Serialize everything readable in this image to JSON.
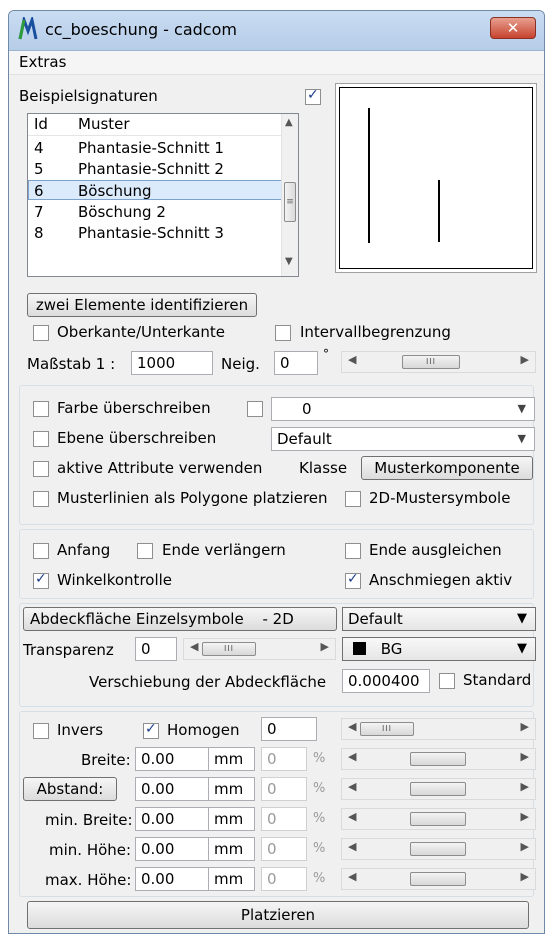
{
  "window": {
    "title": "cc_boeschung - cadcom",
    "close_glyph": "✕"
  },
  "menu": {
    "extras": "Extras"
  },
  "signatures": {
    "label": "Beispielsignaturen",
    "checked": true,
    "headers": {
      "id": "Id",
      "muster": "Muster"
    },
    "rows": [
      {
        "id": "4",
        "name": "Phantasie-Schnitt 1",
        "selected": false
      },
      {
        "id": "5",
        "name": "Phantasie-Schnitt 2",
        "selected": false
      },
      {
        "id": "6",
        "name": "Böschung",
        "selected": true
      },
      {
        "id": "7",
        "name": "Böschung 2",
        "selected": false
      },
      {
        "id": "8",
        "name": "Phantasie-Schnitt 3",
        "selected": false
      }
    ]
  },
  "identify": {
    "label": "zwei Elemente identifizieren"
  },
  "options1": {
    "oberkante": "Oberkante/Unterkante",
    "intervall": "Intervallbegrenzung",
    "massstab_label": "Maßstab 1 :",
    "massstab_value": "1000",
    "neig_label": "Neig.",
    "neig_value": "0",
    "degree": "°"
  },
  "overrides": {
    "farbe": "Farbe überschreiben",
    "farbe_value": "0",
    "ebene": "Ebene überschreiben",
    "ebene_value": "Default",
    "aktive": "aktive Attribute verwenden",
    "klasse_label": "Klasse",
    "klasse_value": "Musterkomponente",
    "polygone": "Musterlinien als Polygone platzieren",
    "muster2d": "2D-Mustersymbole"
  },
  "ends": {
    "anfang": "Anfang",
    "ende_verl": "Ende verlängern",
    "ende_ausgl": "Ende ausgleichen",
    "winkel": "Winkelkontrolle",
    "winkel_checked": true,
    "anschmiegen": "Anschmiegen aktiv",
    "anschmiegen_checked": true
  },
  "cover": {
    "mode": "Abdeckfläche Einzelsymbole",
    "mode_suffix": "- 2D",
    "level": "Default",
    "transparenz_label": "Transparenz",
    "transparenz_value": "0",
    "color": "BG",
    "color_swatch": "#000000",
    "shift_label": "Verschiebung der Abdeckfläche",
    "shift_value": "0.000400",
    "standard": "Standard"
  },
  "dims": {
    "invers": "Invers",
    "homogen": "Homogen",
    "homogen_checked": true,
    "homogen_value": "0",
    "rows": [
      {
        "label": "Breite:",
        "value": "0.00",
        "unit": "mm",
        "pct": "0",
        "pct_unit": "%",
        "is_button": false
      },
      {
        "label": "Abstand:",
        "value": "0.00",
        "unit": "mm",
        "pct": "0",
        "pct_unit": "%",
        "is_button": true
      },
      {
        "label": "min. Breite:",
        "value": "0.00",
        "unit": "mm",
        "pct": "0",
        "pct_unit": "%",
        "is_button": false
      },
      {
        "label": "min. Höhe:",
        "value": "0.00",
        "unit": "mm",
        "pct": "0",
        "pct_unit": "%",
        "is_button": false
      },
      {
        "label": "max. Höhe:",
        "value": "0.00",
        "unit": "mm",
        "pct": "0",
        "pct_unit": "%",
        "is_button": false
      }
    ]
  },
  "place": {
    "label": "Platzieren"
  },
  "scroll": {
    "left": "◀",
    "right": "▶",
    "up": "▲",
    "down": "▼",
    "grip": "III",
    "hgrip": "≡"
  }
}
